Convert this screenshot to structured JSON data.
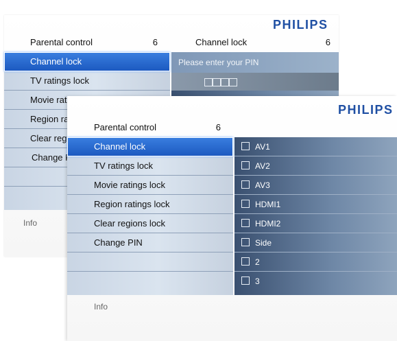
{
  "brand": "PHILIPS",
  "colors": {
    "brand_blue": "#1f4fa3",
    "selection_blue": "#2f6fd6",
    "menu_bg": "#d3dde9",
    "right_panel": "#5a7090"
  },
  "back_screen": {
    "menu_header": "Parental control",
    "menu_count": "6",
    "right_header": "Channel lock",
    "right_count": "6",
    "menu_items": [
      "Channel lock",
      "TV ratings lock",
      "Movie rat",
      "Region ra",
      "Clear regi",
      "Change P",
      "",
      ""
    ],
    "pin_prompt": "Please enter your PIN",
    "pin_digits": 4,
    "info": "Info"
  },
  "front_screen": {
    "menu_header": "Parental control",
    "menu_count": "6",
    "menu_items": [
      "Channel lock",
      "TV ratings lock",
      "Movie ratings lock",
      "Region ratings lock",
      "Clear regions lock",
      "Change PIN",
      "",
      ""
    ],
    "channels": [
      "AV1",
      "AV2",
      "AV3",
      "HDMI1",
      "HDMI2",
      "Side",
      "2",
      "3"
    ],
    "info": "Info"
  }
}
